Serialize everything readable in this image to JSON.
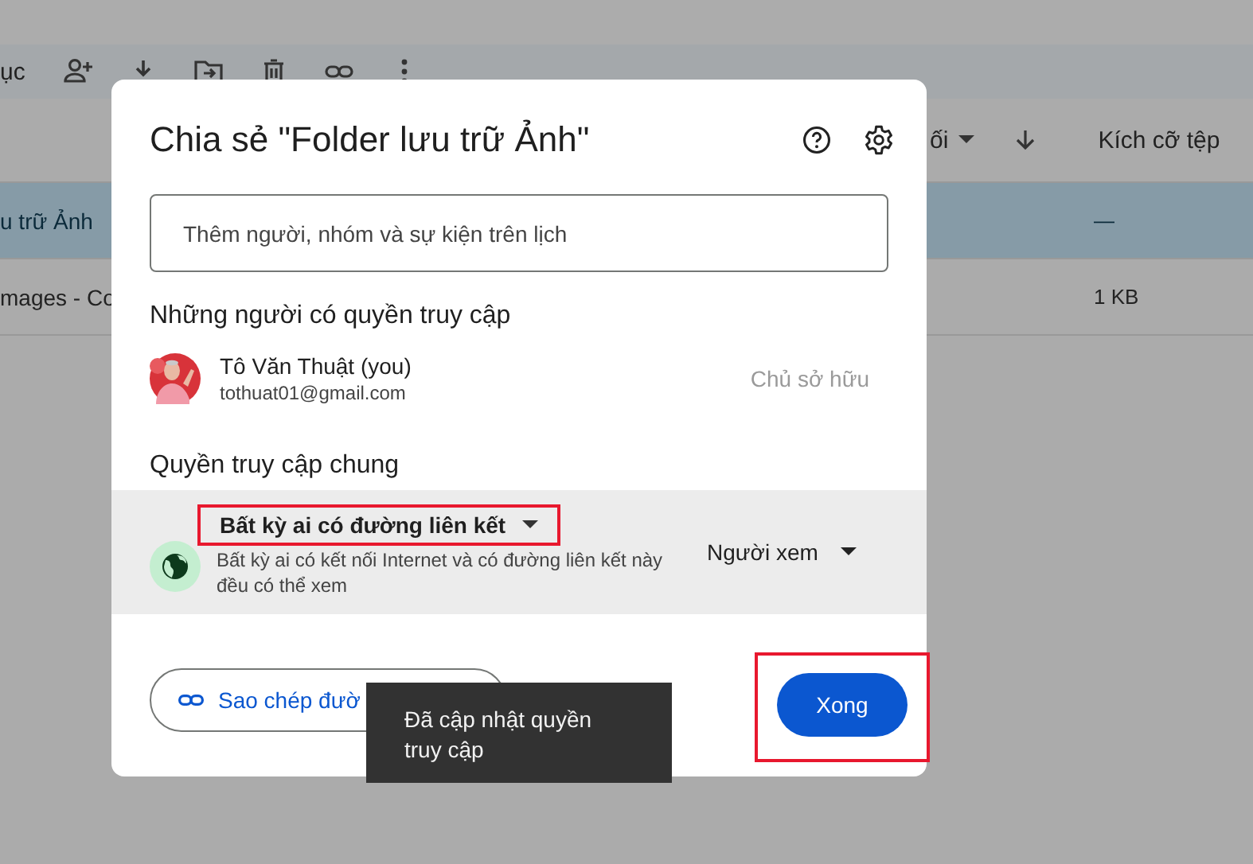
{
  "background": {
    "toolbar": {
      "label": "ục"
    },
    "columns": [
      {
        "label": "ối"
      },
      {
        "label": "Kích cỡ tệp"
      }
    ],
    "rows": [
      {
        "name": "u trữ Ảnh",
        "size": "—",
        "selected": true
      },
      {
        "name": "mages - Co",
        "size": "1 KB",
        "selected": false
      }
    ]
  },
  "dialog": {
    "title": "Chia sẻ \"Folder lưu trữ Ảnh\"",
    "search": {
      "placeholder": "Thêm người, nhóm và sự kiện trên lịch"
    },
    "people_heading": "Những người có quyền truy cập",
    "people": [
      {
        "name": "Tô Văn Thuật (you)",
        "email": "tothuat01@gmail.com",
        "role": "Chủ sở hữu"
      }
    ],
    "general_heading": "Quyền truy cập chung",
    "general_access": {
      "option": "Bất kỳ ai có đường liên kết",
      "description": "Bất kỳ ai có kết nối Internet và có đường liên kết này đều có thể xem",
      "role": "Người xem",
      "highlighted": true
    },
    "copy_link_button": "Sao chép đườ",
    "done_button": {
      "label": "Xong",
      "highlighted": true
    }
  },
  "toast": "Đã cập nhật quyền truy cập"
}
